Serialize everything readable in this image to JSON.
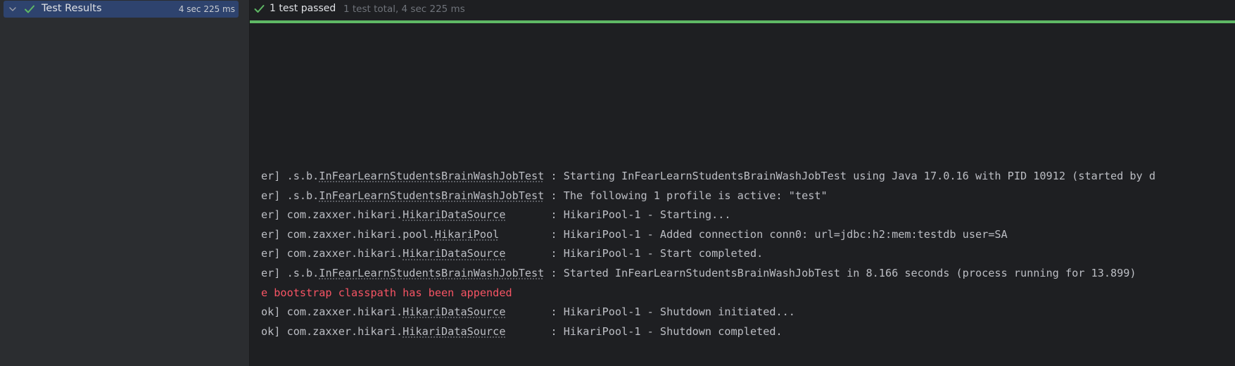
{
  "tree": {
    "root_label": "Test Results",
    "duration": "4 sec 225 ms"
  },
  "status": {
    "passed_label": "1 test passed",
    "total_label": "1 test total, 4 sec 225 ms",
    "progress_fraction": 1.0
  },
  "colors": {
    "pass_green": "#5fb865",
    "selection": "#2e436e",
    "error_red": "#f75464",
    "text": "#bcbec4"
  },
  "log_lines": [
    {
      "prefix": "er] .s.b.",
      "cls": "InFearLearnStudentsBrainWashJobTest",
      "rest": " : Starting InFearLearnStudentsBrainWashJobTest using Java 17.0.16 with PID 10912 (started by d",
      "type": "info"
    },
    {
      "prefix": "er] .s.b.",
      "cls": "InFearLearnStudentsBrainWashJobTest",
      "rest": " : The following 1 profile is active: \"test\"",
      "type": "info"
    },
    {
      "prefix": "er] com.zaxxer.hikari.",
      "cls": "HikariDataSource",
      "rest": "       : HikariPool-1 - Starting...",
      "type": "info"
    },
    {
      "prefix": "er] com.zaxxer.hikari.pool.",
      "cls": "HikariPool",
      "rest": "        : HikariPool-1 - Added connection conn0: url=jdbc:h2:mem:testdb user=SA",
      "type": "info"
    },
    {
      "prefix": "er] com.zaxxer.hikari.",
      "cls": "HikariDataSource",
      "rest": "       : HikariPool-1 - Start completed.",
      "type": "info"
    },
    {
      "prefix": "er] .s.b.",
      "cls": "InFearLearnStudentsBrainWashJobTest",
      "rest": " : Started InFearLearnStudentsBrainWashJobTest in 8.166 seconds (process running for 13.899)",
      "type": "info"
    },
    {
      "prefix": "e bootstrap classpath has been appended",
      "cls": "",
      "rest": "",
      "type": "err"
    },
    {
      "prefix": "ok] com.zaxxer.hikari.",
      "cls": "HikariDataSource",
      "rest": "       : HikariPool-1 - Shutdown initiated...",
      "type": "info"
    },
    {
      "prefix": "ok] com.zaxxer.hikari.",
      "cls": "HikariDataSource",
      "rest": "       : HikariPool-1 - Shutdown completed.",
      "type": "info"
    }
  ]
}
